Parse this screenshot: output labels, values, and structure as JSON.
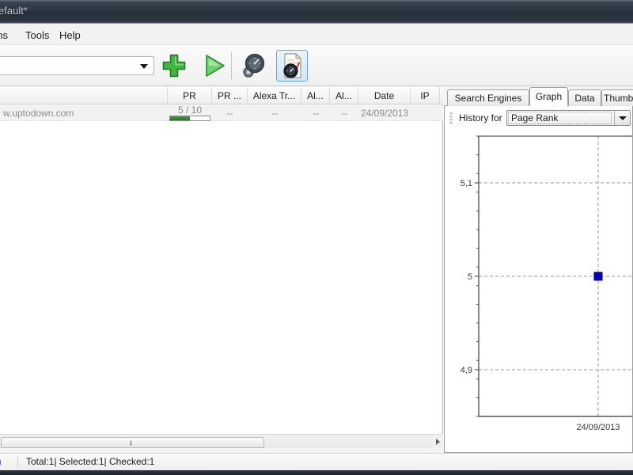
{
  "window": {
    "title": "efault*"
  },
  "menu": {
    "items": [
      {
        "label": "ons"
      },
      {
        "label": "Tools"
      },
      {
        "label": "Help"
      }
    ]
  },
  "toolbar": {
    "combo_value": "",
    "combo_placeholder": "",
    "buttons": [
      {
        "name": "add-url-button",
        "icon": "plus-icon"
      },
      {
        "name": "start-check-button",
        "icon": "play-icon"
      },
      {
        "name": "gauge-button",
        "icon": "gauge-icon"
      },
      {
        "name": "report-button",
        "icon": "report-gauge-icon",
        "selected": true
      }
    ]
  },
  "table": {
    "columns": [
      {
        "label": "",
        "key": "url"
      },
      {
        "label": "PR",
        "key": "pr"
      },
      {
        "label": "PR ...",
        "key": "pr2"
      },
      {
        "label": "Alexa Tr...",
        "key": "alexa"
      },
      {
        "label": "Al...",
        "key": "al1"
      },
      {
        "label": "Al...",
        "key": "al2"
      },
      {
        "label": "Date",
        "key": "date"
      },
      {
        "label": "IP",
        "key": "ip"
      }
    ],
    "rows": [
      {
        "url": "w.uptodown.com",
        "pr_label": "5 / 10",
        "pr_value": 5,
        "pr_max": 10,
        "pr2": "--",
        "alexa": "--",
        "al1": "--",
        "al2": "--",
        "date": "24/09/2013",
        "ip": ""
      }
    ]
  },
  "scrollbar": {
    "grip": "‖",
    "right_arrow": "right-arrow-icon"
  },
  "statusbar": {
    "link_text": "n",
    "summary": "Total:1| Selected:1| Checked:1"
  },
  "right_panel": {
    "tabs": [
      {
        "label": "Search Engines",
        "active": false
      },
      {
        "label": "Graph",
        "active": true
      },
      {
        "label": "Data",
        "active": false
      },
      {
        "label": "Thumbn",
        "active": false
      }
    ],
    "history": {
      "label": "History for",
      "selected": "Page Rank"
    }
  },
  "chart_data": {
    "type": "scatter",
    "title": "",
    "xlabel": "",
    "ylabel": "",
    "x": [
      "24/09/2013"
    ],
    "values": [
      5
    ],
    "series": [
      {
        "name": "Page Rank",
        "values": [
          5
        ],
        "color": "#0000cc"
      }
    ],
    "ylim": [
      4.85,
      5.15
    ],
    "ytick_labels": [
      "5,1",
      "5",
      "4,9"
    ],
    "ytick_values": [
      5.1,
      5.0,
      4.9
    ],
    "yminor_count": 4,
    "xtick_labels": [
      "24/09/2013"
    ],
    "grid": true,
    "grid_style": "dashed",
    "grid_color": "#999999",
    "axis_color": "#555555",
    "legend": "none",
    "marker": "square",
    "marker_color": "#0000cc"
  }
}
